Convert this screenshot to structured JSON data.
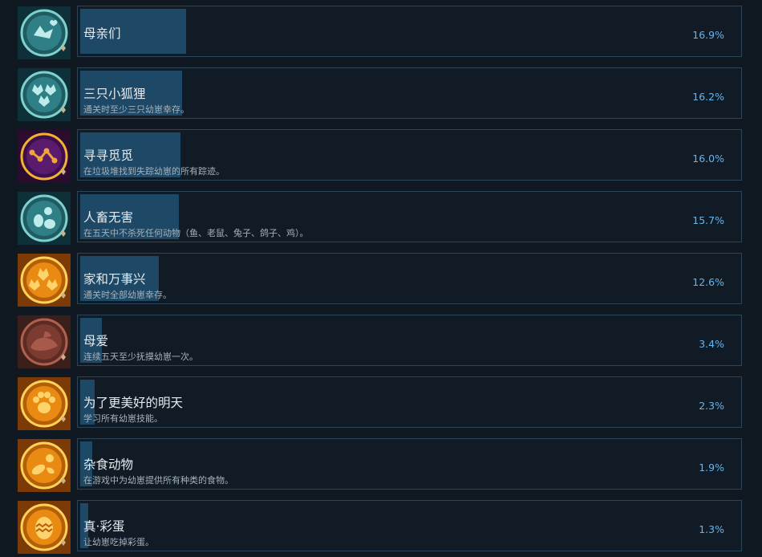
{
  "achievements": [
    {
      "title": "母亲们",
      "desc": "",
      "percent_label": "16.9%",
      "percent": 16.9,
      "icon": "fox-hearts-icon",
      "icon_style": "teal"
    },
    {
      "title": "三只小狐狸",
      "desc": "通关时至少三只幼崽幸存。",
      "percent_label": "16.2%",
      "percent": 16.2,
      "icon": "three-foxes-icon",
      "icon_style": "teal"
    },
    {
      "title": "寻寻觅觅",
      "desc": "在垃圾堆找到失踪幼崽的所有踪迹。",
      "percent_label": "16.0%",
      "percent": 16.0,
      "icon": "trail-path-icon",
      "icon_style": "purple"
    },
    {
      "title": "人畜无害",
      "desc": "在五天中不杀死任何动物（鱼、老鼠、兔子、鸽子、鸡）。",
      "percent_label": "15.7%",
      "percent": 15.7,
      "icon": "animals-icon",
      "icon_style": "teal"
    },
    {
      "title": "家和万事兴",
      "desc": "通关时全部幼崽幸存。",
      "percent_label": "12.6%",
      "percent": 12.6,
      "icon": "fox-family-icon",
      "icon_style": "orange"
    },
    {
      "title": "母爱",
      "desc": "连续五天至少抚摸幼崽一次。",
      "percent_label": "3.4%",
      "percent": 3.4,
      "icon": "petting-hand-icon",
      "icon_style": "brown"
    },
    {
      "title": "为了更美好的明天",
      "desc": "学习所有幼崽技能。",
      "percent_label": "2.3%",
      "percent": 2.3,
      "icon": "paw-icon",
      "icon_style": "orange"
    },
    {
      "title": "杂食动物",
      "desc": "在游戏中为幼崽提供所有种类的食物。",
      "percent_label": "1.9%",
      "percent": 1.9,
      "icon": "food-icon",
      "icon_style": "orange"
    },
    {
      "title": "真·彩蛋",
      "desc": "让幼崽吃掉彩蛋。",
      "percent_label": "1.3%",
      "percent": 1.3,
      "icon": "egg-icon",
      "icon_style": "orange"
    }
  ]
}
